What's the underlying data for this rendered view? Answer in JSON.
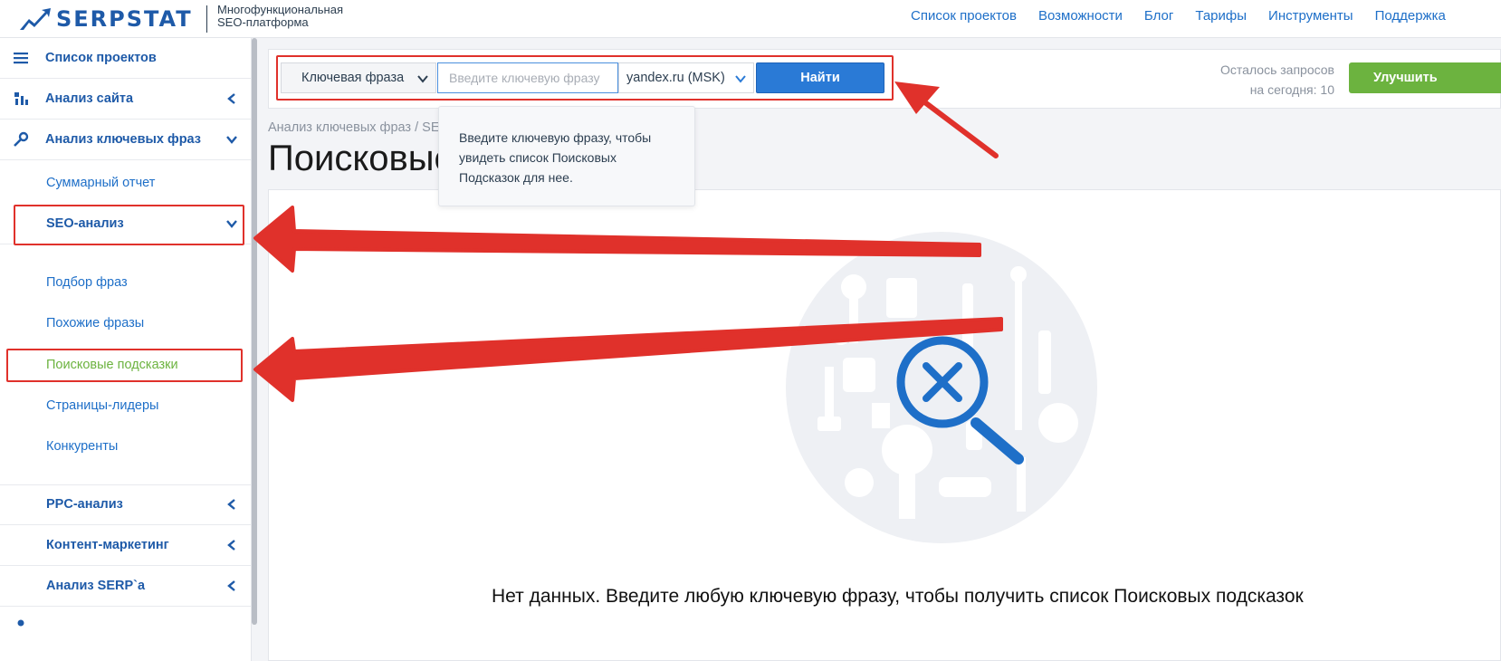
{
  "header": {
    "logo_text": "SERPSTAT",
    "tagline_line1": "Многофункциональная",
    "tagline_line2": "SEO-платформа",
    "nav": [
      "Список проектов",
      "Возможности",
      "Блог",
      "Тарифы",
      "Инструменты",
      "Поддержка"
    ]
  },
  "sidebar": {
    "projects": "Список проектов",
    "site_analysis": "Анализ сайта",
    "keyword_analysis": "Анализ ключевых фраз",
    "summary": "Суммарный отчет",
    "seo_analysis": "SEO-анализ",
    "phrase_selection": "Подбор фраз",
    "similar_phrases": "Похожие фразы",
    "search_suggestions": "Поисковые подсказки",
    "top_pages": "Страницы-лидеры",
    "competitors": "Конкуренты",
    "ppc": "PPC-анализ",
    "content_marketing": "Контент-маркетинг",
    "serp": "Анализ SERP`а"
  },
  "search": {
    "type_label": "Ключевая фраза",
    "placeholder": "Введите ключевую фразу",
    "database": "yandex.ru (MSK)",
    "find_label": "Найти",
    "quota_line1": "Осталось запросов",
    "quota_line2": "на сегодня: 10",
    "upgrade_label": "Улучшить"
  },
  "breadcrumb": "Анализ ключевых фраз / SEO-анализ",
  "page_title": "Поисковые подсказки",
  "tooltip": "Введите ключевую фразу, чтобы увидеть список Поисковых Подсказок для нее.",
  "empty_state": "Нет данных. Введите любую ключевую фразу, чтобы получить список Поисковых подсказок",
  "colors": {
    "brand": "#1e5aa8",
    "accent": "#2a7ad6",
    "active": "#6cb33f",
    "annotation": "#e0312b"
  }
}
